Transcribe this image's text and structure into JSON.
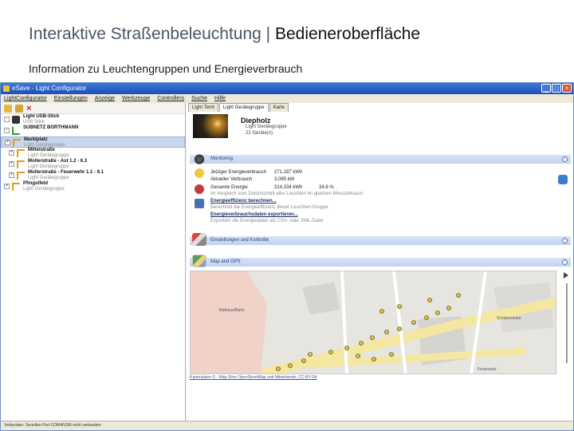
{
  "slide": {
    "title_prefix": "Interaktive Straßenbeleuchtung | ",
    "title_emphasis": "Bedieneroberfläche",
    "subtitle": "Information zu Leuchtengruppen und Energieverbrauch"
  },
  "window": {
    "title": "eSave - Light Configurator",
    "buttons": [
      "_",
      "□",
      "×"
    ]
  },
  "menu": [
    "LightConfigurator",
    "Einstellungen",
    "Anzeige",
    "Werkzeuge",
    "Controllers",
    "Suche",
    "Hilfe"
  ],
  "tree": [
    {
      "name": "Light USB-Stick",
      "sub": "USB Stick",
      "icon": "usb-icon",
      "toggle": "-",
      "indent": 0
    },
    {
      "name": "SUBNETZ BORTHMANN",
      "sub": "",
      "icon": "signal-icon",
      "toggle": "-",
      "indent": 0
    },
    {
      "name": "Marktplatz",
      "sub": "Light Gerätegruppe",
      "icon": "lamp-icon",
      "toggle": "+",
      "indent": 0,
      "selected": true
    },
    {
      "name": "Mittelstraße",
      "sub": "Light Gerätegruppe",
      "icon": "lamp-icon",
      "toggle": "+",
      "indent": 1
    },
    {
      "name": "Mollerstraße - Ast 1.2 - 6.3",
      "sub": "Light Gerätegruppe",
      "icon": "lamp-icon",
      "toggle": "+",
      "indent": 1
    },
    {
      "name": "Mollerstraße - Feuerwehr 1.1 - 6.1",
      "sub": "Light Gerätegruppe",
      "icon": "lamp-icon",
      "toggle": "+",
      "indent": 1
    },
    {
      "name": "Pfingstfeld",
      "sub": "Light Gerätegruppe",
      "icon": "lamp-icon",
      "toggle": "+",
      "indent": 0
    }
  ],
  "tabs": [
    "Light Territ",
    "Light Gerätegruppe",
    "Karte"
  ],
  "detail": {
    "title": "Diepholz",
    "sub1": "Light Gerätegruppe",
    "sub2": "22 Geräte(n)"
  },
  "sections": {
    "monitoring": "Monitoring",
    "settings": "Einstellungen und Kontrolle",
    "map": "Map and GPS",
    "chevron": "›"
  },
  "energy": {
    "rows": [
      {
        "label": "Jetziger Energieverbrauch",
        "value": "271,187 kWh",
        "pct": ""
      },
      {
        "label": "Aktueller Verbrauch",
        "value": "3,085 kW",
        "pct": ""
      },
      {
        "label": "Gesamte Energie",
        "value": "314,334 kWh",
        "pct": "34,6 %"
      }
    ],
    "note1": "im Vergleich zum Durchschnitt aller Leuchten im gleichen Messzeitraum",
    "link1": "Energieeffizienz berechnen...",
    "note2": "Berechnet die Energieeffizienz dieser Leuchten-Gruppe",
    "link2": "Energieverbrauchsdaten exportieren...",
    "note3": "Exportiert die Energiedaten als CSV- oder XML-Datei"
  },
  "map": {
    "credit": "Kartendaten © - Map Sites OpenStreetMap und Mitwirkende, CC-BY-SA",
    "labels": [
      {
        "text": "Rathaus/Bahn"
      },
      {
        "text": "Feuerwehr"
      },
      {
        "text": "Schulzentrum"
      }
    ],
    "road_color": "#f3e7a1",
    "park_color": "#f0d2c8",
    "marker_color": "#e2c22a"
  },
  "status": "Verbunden: Seriellen-Port COM4/USB nicht verbunden"
}
